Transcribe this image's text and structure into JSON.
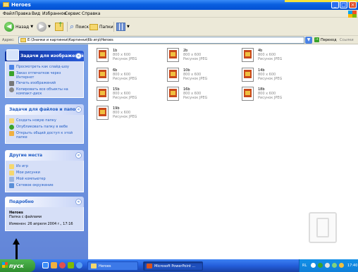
{
  "window": {
    "title": "Heroes"
  },
  "menu": [
    "Файл",
    "Правка",
    "Вид",
    "Избранное",
    "Сервис",
    "Справка"
  ],
  "toolbar": {
    "back": "Назад",
    "search": "Поиск",
    "folders": "Папки"
  },
  "address": {
    "label": "Адрес:",
    "value": "E:\\Значки и картинки\\Картинки\\6b игр\\Heroes",
    "go": "Переход",
    "links": "Ссылки"
  },
  "taskpane": {
    "picture_tasks": {
      "title": "Задачи для изображений",
      "items": [
        "Просмотреть как слайд-шоу",
        "Заказ отпечатков через Интернет",
        "Печать изображений",
        "Копировать все объекты на компакт-диск"
      ]
    },
    "file_tasks": {
      "title": "Задачи для файлов и папок",
      "items": [
        "Создать новую папку",
        "Опубликовать папку в вебе",
        "Открыть общий доступ к этой папке"
      ]
    },
    "other_places": {
      "title": "Другие места",
      "items": [
        "Из игр",
        "Мои рисунки",
        "Мой компьютер",
        "Сетевое окружение"
      ]
    },
    "details": {
      "title": "Подробно",
      "name": "Heroes",
      "type": "Папка с файлами",
      "modified": "Изменен: 26 апреля 2004 г., 17:16"
    }
  },
  "files": [
    {
      "name": "1b",
      "dim": "800 x 600",
      "type": "Рисунок JPEG"
    },
    {
      "name": "2b",
      "dim": "800 x 600",
      "type": "Рисунок JPEG"
    },
    {
      "name": "4b",
      "dim": "800 x 600",
      "type": "Рисунок JPEG"
    },
    {
      "name": "6b",
      "dim": "800 x 600",
      "type": "Рисунок JPEG"
    },
    {
      "name": "10b",
      "dim": "800 x 600",
      "type": "Рисунок JPEG"
    },
    {
      "name": "14b",
      "dim": "800 x 600",
      "type": "Рисунок JPEG"
    },
    {
      "name": "15b",
      "dim": "800 x 600",
      "type": "Рисунок JPEG"
    },
    {
      "name": "16b",
      "dim": "800 x 600",
      "type": "Рисунок JPEG"
    },
    {
      "name": "18b",
      "dim": "800 x 600",
      "type": "Рисунок JPEG"
    },
    {
      "name": "19b",
      "dim": "800 x 600",
      "type": "Рисунок JPEG"
    }
  ],
  "taskbar": {
    "start": "пуск",
    "tasks": [
      "Heroes",
      "Microsoft PowerPoint ..."
    ],
    "lang": "RL",
    "clock": "17:40"
  }
}
